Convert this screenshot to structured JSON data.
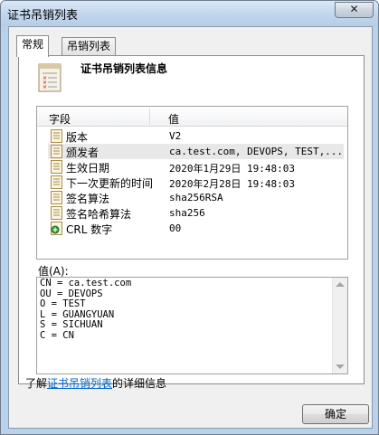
{
  "window": {
    "title": "证书吊销列表",
    "close_glyph": "✕"
  },
  "tabs": [
    {
      "label": "常规",
      "active": true
    },
    {
      "label": "吊销列表",
      "active": false
    }
  ],
  "general": {
    "heading": "证书吊销列表信息",
    "columns": {
      "field": "字段",
      "value": "值"
    },
    "rows": [
      {
        "field": "版本",
        "value": "V2",
        "icon": "document-field-icon"
      },
      {
        "field": "颁发者",
        "value": "ca.test.com, DEVOPS, TEST,...",
        "icon": "document-field-icon",
        "selected": true
      },
      {
        "field": "生效日期",
        "value": "2020年1月29日 19:48:03",
        "icon": "document-field-icon"
      },
      {
        "field": "下一次更新的时间",
        "value": "2020年2月28日 19:48:03",
        "icon": "document-field-icon"
      },
      {
        "field": "签名算法",
        "value": "sha256RSA",
        "icon": "document-field-icon"
      },
      {
        "field": "签名哈希算法",
        "value": "sha256",
        "icon": "document-field-icon"
      },
      {
        "field": "CRL 数字",
        "value": "00",
        "icon": "extension-field-icon"
      }
    ],
    "value_label": "值(A):",
    "value_text": "CN = ca.test.com\nOU = DEVOPS\nO = TEST\nL = GUANGYUAN\nS = SICHUAN\nC = CN",
    "learn_more_prefix": "了解",
    "learn_more_link": "证书吊销列表",
    "learn_more_suffix": "的详细信息"
  },
  "buttons": {
    "ok": "确定"
  },
  "colors": {
    "link": "#0066cc",
    "window_frame": "#b9d1ea"
  }
}
